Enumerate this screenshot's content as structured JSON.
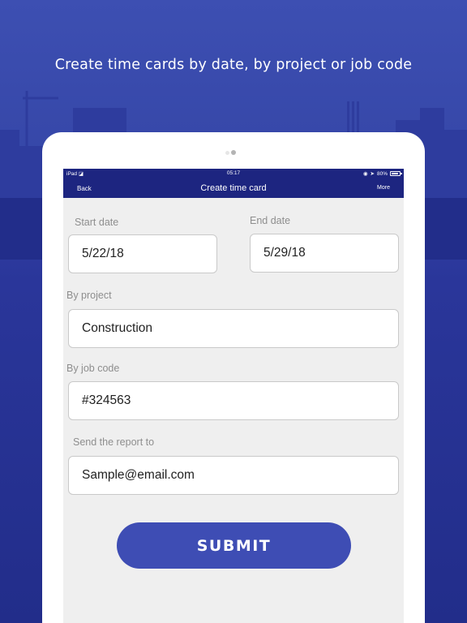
{
  "promo": {
    "headline": "Create time cards by date, by project or job code"
  },
  "status_bar": {
    "carrier": "iPad",
    "time": "05:17",
    "battery": "80%"
  },
  "nav": {
    "back_label": "Back",
    "title": "Create time card",
    "more_label": "More"
  },
  "form": {
    "start_date": {
      "label": "Start date",
      "value": "5/22/18"
    },
    "end_date": {
      "label": "End date",
      "value": "5/29/18"
    },
    "project": {
      "label": "By project",
      "value": "Construction"
    },
    "job_code": {
      "label": "By job code",
      "value": "#324563"
    },
    "report_to": {
      "label": "Send the report to",
      "value": "Sample@email.com"
    },
    "submit_label": "SUBMIT"
  },
  "colors": {
    "background": "#3647a8",
    "navbar": "#1d2580",
    "accent": "#3e4db4",
    "screen": "#efefef"
  }
}
